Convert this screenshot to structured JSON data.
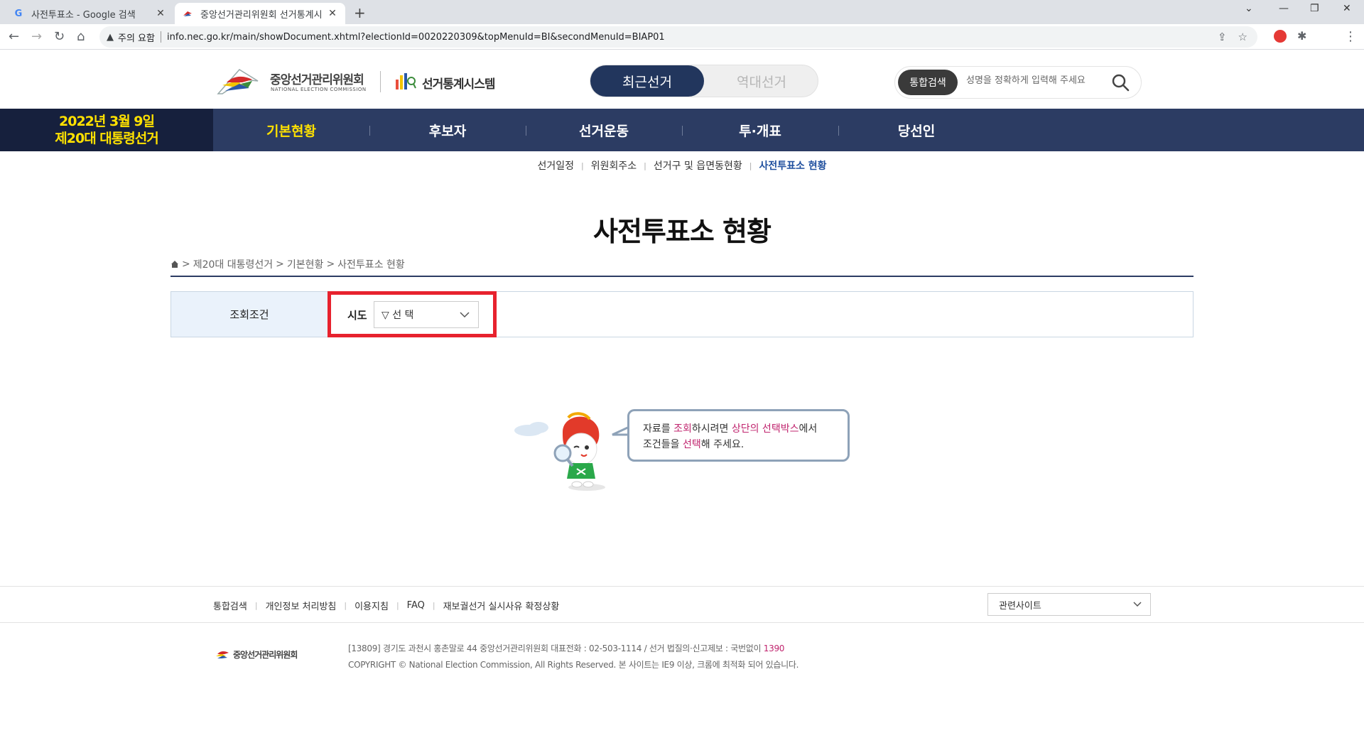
{
  "browser": {
    "tabs": [
      {
        "title": "사전투표소 - Google 검색",
        "favicon": "G"
      },
      {
        "title": "중앙선거관리위원회 선거통계시",
        "favicon": "nec-logo"
      }
    ],
    "security_label": "주의 요함",
    "url": "info.nec.go.kr/main/showDocument.xhtml?electionId=0020220309&topMenuId=BI&secondMenuId=BIAP01",
    "new_tab": "+",
    "close": "✕"
  },
  "header": {
    "org_name": "중앙선거관리위원회",
    "org_name_en": "NATIONAL ELECTION COMMISSION",
    "system_name": "선거통계시스템",
    "toggle_recent": "최근선거",
    "toggle_past": "역대선거",
    "search_label": "통합검색",
    "search_placeholder": "성명을 정확하게 입력해 주세요"
  },
  "gnb": {
    "election_date": "2022년 3월 9일",
    "election_name": "제20대 대통령선거",
    "menu": [
      "기본현황",
      "후보자",
      "선거운동",
      "투·개표",
      "당선인"
    ]
  },
  "submenu": [
    "선거일정",
    "위원회주소",
    "선거구 및 읍면동현황",
    "사전투표소 현황"
  ],
  "page": {
    "title": "사전투표소 현황",
    "breadcrumb": [
      "제20대 대통령선거",
      "기본현황",
      "사전투표소 현황"
    ],
    "breadcrumb_sep": ">"
  },
  "query": {
    "label": "조회조건",
    "sido_label": "시도",
    "sido_value": "▽ 선 택"
  },
  "guide": {
    "line1_a": "자료를 ",
    "line1_b": "조회",
    "line1_c": "하시려면 ",
    "line1_d": "상단의 선택박스",
    "line1_e": "에서",
    "line2_a": "조건들을 ",
    "line2_b": "선택",
    "line2_c": "해 주세요."
  },
  "footer": {
    "links": [
      "통합검색",
      "개인정보 처리방침",
      "이용지침",
      "FAQ",
      "재보궐선거 실시사유 확정상황"
    ],
    "related": "관련사이트",
    "logo_text": "중앙선거관리위원회",
    "address": "[13809] 경기도 과천시 홍촌말로 44 중앙선거관리위원회 대표전화 : 02-503-1114 / 선거 법질의·신고제보 : 국번없이 ",
    "hotline": "1390",
    "copyright": "COPYRIGHT © National Election Commission, All Rights Reserved. 본 사이트는 IE9 이상, 크롬에 최적화 되어 있습니다."
  },
  "colors": {
    "navy": "#2c3c63",
    "highlight_yellow": "#ffe100",
    "red_box": "#e7222e",
    "accent_pink": "#c0246e"
  }
}
